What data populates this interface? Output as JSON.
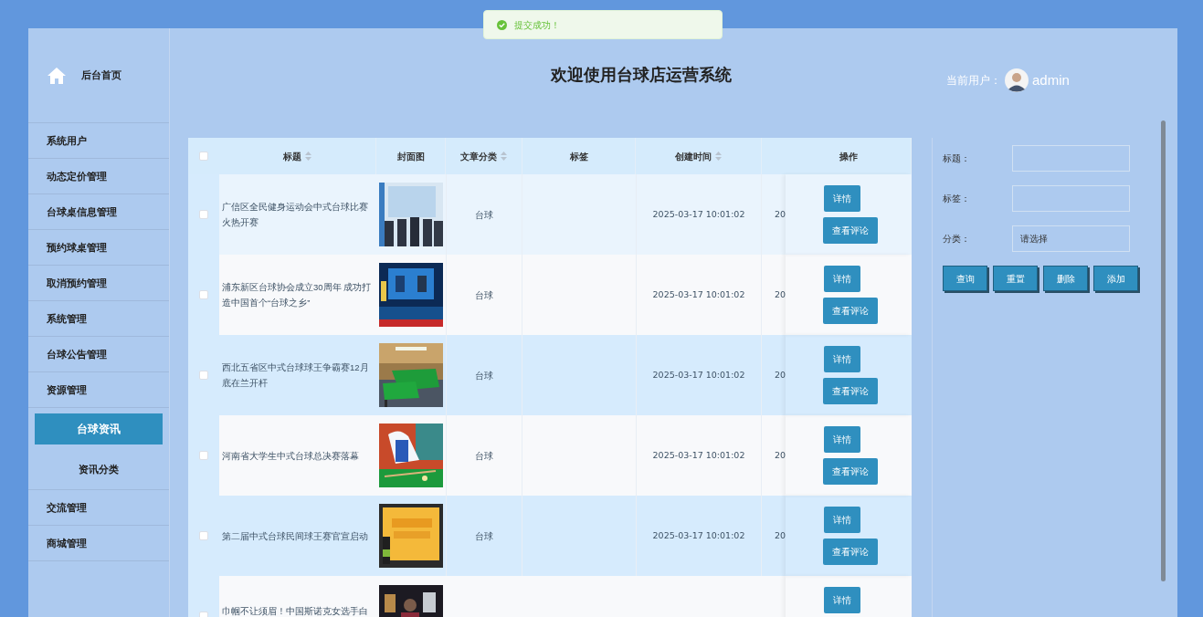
{
  "toast": {
    "text": "提交成功！"
  },
  "sidebar": {
    "home": "后台首页",
    "items": [
      {
        "label": "系统用户",
        "selected": false
      },
      {
        "label": "动态定价管理",
        "selected": false
      },
      {
        "label": "台球桌信息管理",
        "selected": false
      },
      {
        "label": "预约球桌管理",
        "selected": false
      },
      {
        "label": "取消预约管理",
        "selected": false
      },
      {
        "label": "系统管理",
        "selected": false
      },
      {
        "label": "台球公告管理",
        "selected": false
      },
      {
        "label": "资源管理",
        "selected": false
      },
      {
        "label": "台球资讯",
        "selected": true,
        "children": [
          {
            "label": "资讯分类",
            "selected": false
          }
        ]
      },
      {
        "label": "交流管理",
        "selected": false
      },
      {
        "label": "商城管理",
        "selected": false
      }
    ]
  },
  "header": {
    "title": "欢迎使用台球店运营系统",
    "user_label": "当前用户：",
    "username": "admin"
  },
  "table": {
    "select_all": {
      "checked": false
    },
    "columns": [
      {
        "label": "标题",
        "sortable": true
      },
      {
        "label": "封面图",
        "sortable": false
      },
      {
        "label": "文章分类",
        "sortable": true
      },
      {
        "label": "标签",
        "sortable": false
      },
      {
        "label": "创建时间",
        "sortable": true
      },
      {
        "label": "操作",
        "sortable": false
      }
    ],
    "rows": [
      {
        "title": "广信区全民健身运动会中式台球比赛火热开赛",
        "category": "台球",
        "created": "2025-03-17 10:01:02",
        "updated": "20",
        "checked": false,
        "actions": [
          "详情",
          "查看评论"
        ]
      },
      {
        "title": "浦东新区台球协会成立30周年 成功打造中国首个“台球之乡”",
        "category": "台球",
        "created": "2025-03-17 10:01:02",
        "updated": "20",
        "checked": false,
        "actions": [
          "详情",
          "查看评论"
        ]
      },
      {
        "title": "西北五省区中式台球球王争霸赛12月底在兰开杆",
        "category": "台球",
        "created": "2025-03-17 10:01:02",
        "updated": "20",
        "checked": false,
        "actions": [
          "详情",
          "查看评论"
        ]
      },
      {
        "title": "河南省大学生中式台球总决赛落幕",
        "category": "台球",
        "created": "2025-03-17 10:01:02",
        "updated": "20",
        "checked": false,
        "actions": [
          "详情",
          "查看评论"
        ]
      },
      {
        "title": "第二届中式台球民间球王赛官宣启动",
        "category": "台球",
        "created": "2025-03-17 10:01:02",
        "updated": "20",
        "checked": false,
        "actions": [
          "详情",
          "查看评论"
        ]
      },
      {
        "title": "巾帼不让须眉！中国斯诺克女选手白",
        "checked": false,
        "actions": [
          "详情"
        ]
      }
    ]
  },
  "search": {
    "fields": [
      {
        "label": "标题：",
        "kind": "text"
      },
      {
        "label": "标签：",
        "kind": "text"
      },
      {
        "label": "分类：",
        "kind": "select",
        "value": "请选择"
      }
    ],
    "buttons": [
      "查询",
      "重置",
      "删除",
      "添加"
    ]
  }
}
